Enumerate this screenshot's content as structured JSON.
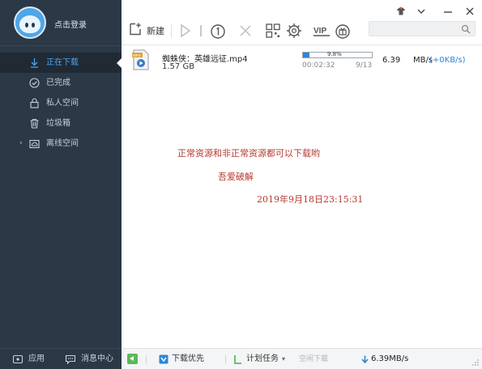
{
  "user": {
    "login_label": "点击登录"
  },
  "sidebar": {
    "items": [
      {
        "label": "正在下载",
        "icon": "download-arrow-icon",
        "active": true
      },
      {
        "label": "已完成",
        "icon": "check-circle-icon",
        "active": false
      },
      {
        "label": "私人空间",
        "icon": "lock-icon",
        "active": false
      },
      {
        "label": "垃圾箱",
        "icon": "trash-icon",
        "active": false
      },
      {
        "label": "离线空间",
        "icon": "cloud-folder-icon",
        "active": false,
        "expandable": true
      }
    ],
    "footer": {
      "apps_label": "应用",
      "messages_label": "消息中心"
    }
  },
  "toolbar": {
    "new_label": "新建",
    "buttons": [
      "play-icon",
      "pause-icon",
      "limit-speed-icon",
      "delete-icon",
      "qr-code-icon",
      "settings-icon",
      "vip-icon",
      "gift-icon"
    ],
    "search_placeholder": ""
  },
  "task": {
    "name": "蜘蛛侠：英雄远征.mp4",
    "size": "1.57 GB",
    "progress_percent": 9.8,
    "progress_label": "9.8%",
    "elapsed": "00:02:32",
    "count": "9/13",
    "speed": "6.39",
    "speed_unit": "MB/s",
    "upload_speed": "(+0KB/s)"
  },
  "watermark": {
    "line1": "正常资源和非正常资源都可以下载哟",
    "line2": "吾爱破解",
    "line3": "2019年9月18日23:15:31"
  },
  "bottom": {
    "priority_label": "下载优先",
    "plan_label": "计划任务",
    "idle_label": "空闲下载",
    "total_speed": "6.39MB/s"
  },
  "colors": {
    "sidebar_bg": "#2b3845",
    "accent": "#2f86d8",
    "watermark": "#b5392f"
  }
}
